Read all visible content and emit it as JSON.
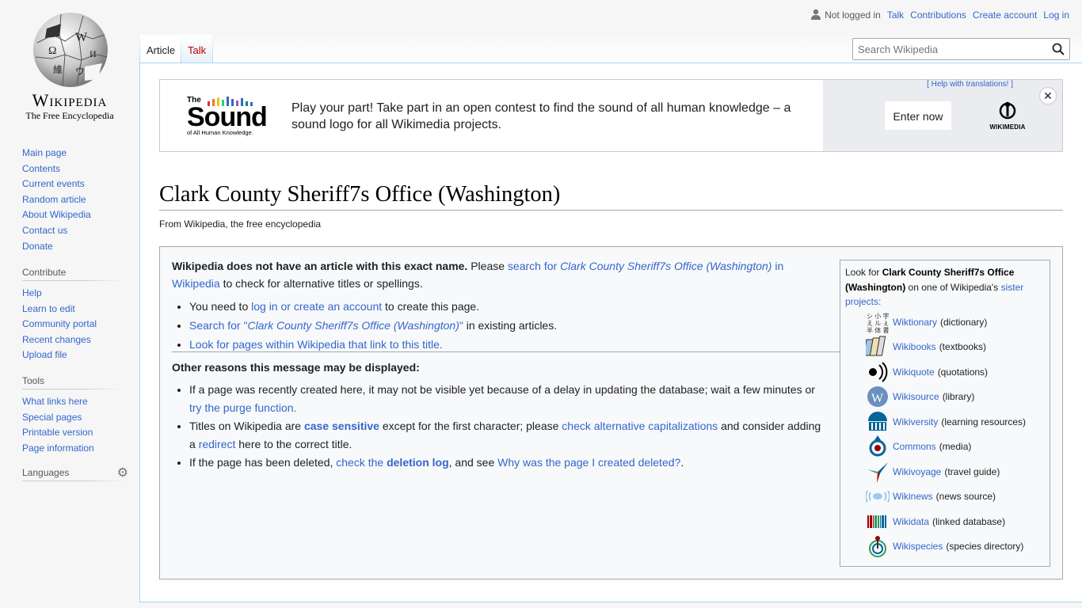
{
  "logo": {
    "wordmark": "Wikipedia",
    "tagline": "The Free Encyclopedia"
  },
  "personal": {
    "not_logged_in": "Not logged in",
    "talk": "Talk",
    "contributions": "Contributions",
    "create_account": "Create account",
    "login": "Log in"
  },
  "tabs": {
    "article": "Article",
    "talk": "Talk"
  },
  "search": {
    "placeholder": "Search Wikipedia"
  },
  "sidebar": {
    "navigation": [
      "Main page",
      "Contents",
      "Current events",
      "Random article",
      "About Wikipedia",
      "Contact us",
      "Donate"
    ],
    "contribute": {
      "heading": "Contribute",
      "items": [
        "Help",
        "Learn to edit",
        "Community portal",
        "Recent changes",
        "Upload file"
      ]
    },
    "tools": {
      "heading": "Tools",
      "items": [
        "What links here",
        "Special pages",
        "Printable version",
        "Page information"
      ]
    },
    "languages": {
      "heading": "Languages"
    }
  },
  "banner": {
    "logo_the": "The",
    "logo_sound": "Sound",
    "logo_sub": "of All Human Knowledge.",
    "message": "Play your part! Take part in an open contest to find the sound of all human knowledge – a sound logo for all Wikimedia projects.",
    "help": "[ Help with translations! ]",
    "enter": "Enter now",
    "wikimedia": "WIKIMEDIA",
    "close": "✕"
  },
  "page": {
    "title": "Clark County Sheriff7s Office (Washington)",
    "tagline": "From Wikipedia, the free encyclopedia"
  },
  "noarticle": {
    "intro_bold": "Wikipedia does not have an article with this exact name.",
    "intro_please": " Please ",
    "intro_link_pre": "search for ",
    "intro_link_italic": "Clark County Sheriff7s Office (Washington)",
    "intro_link_post": " in Wikipedia",
    "intro_tail": " to check for alternative titles or spellings.",
    "bullet1_pre": "You need to ",
    "bullet1_link": "log in or create an account",
    "bullet1_post": " to create this page.",
    "bullet2_link_pre": "Search for \"",
    "bullet2_link_italic": "Clark County Sheriff7s Office (Washington)",
    "bullet2_link_post": "\"",
    "bullet2_post": " in existing articles.",
    "bullet3_link": "Look for pages within Wikipedia that link to this title",
    "bullet3_post": ".",
    "reasons_heading": "Other reasons this message may be displayed:",
    "r1_pre": "If a page was recently created here, it may not be visible yet because of a delay in updating the database; wait a few minutes or ",
    "r1_link": "try the purge function",
    "r1_post": ".",
    "r2_pre": "Titles on Wikipedia are ",
    "r2_link1": "case sensitive",
    "r2_mid": " except for the first character; please ",
    "r2_link2": "check alternative capitalizations",
    "r2_mid2": " and consider adding a ",
    "r2_link3": "redirect",
    "r2_post": " here to the correct title.",
    "r3_pre": "If the page has been deleted, ",
    "r3_link1_pre": "check the ",
    "r3_link1_bold": "deletion log",
    "r3_mid": ", and see ",
    "r3_link2": "Why was the page I created deleted?",
    "r3_post": "."
  },
  "sister": {
    "look_for": "Look for ",
    "title": "Clark County Sheriff7s Office (Washington)",
    "on_one": " on one of Wikipedia's ",
    "sister_link": "sister projects",
    "colon": ":",
    "projects": [
      {
        "name": "Wiktionary",
        "desc": "(dictionary)",
        "icon": "wiktionary-icon"
      },
      {
        "name": "Wikibooks",
        "desc": "(textbooks)",
        "icon": "wikibooks-icon"
      },
      {
        "name": "Wikiquote",
        "desc": "(quotations)",
        "icon": "wikiquote-icon"
      },
      {
        "name": "Wikisource",
        "desc": "(library)",
        "icon": "wikisource-icon"
      },
      {
        "name": "Wikiversity",
        "desc": "(learning resources)",
        "icon": "wikiversity-icon"
      },
      {
        "name": "Commons",
        "desc": "(media)",
        "icon": "commons-icon"
      },
      {
        "name": "Wikivoyage",
        "desc": "(travel guide)",
        "icon": "wikivoyage-icon"
      },
      {
        "name": "Wikinews",
        "desc": "(news source)",
        "icon": "wikinews-icon"
      },
      {
        "name": "Wikidata",
        "desc": "(linked database)",
        "icon": "wikidata-icon"
      },
      {
        "name": "Wikispecies",
        "desc": "(species directory)",
        "icon": "wikispecies-icon"
      }
    ]
  },
  "colors": {
    "link": "#3366cc",
    "talk_tab": "#ba0000",
    "border": "#a2a9b1"
  }
}
